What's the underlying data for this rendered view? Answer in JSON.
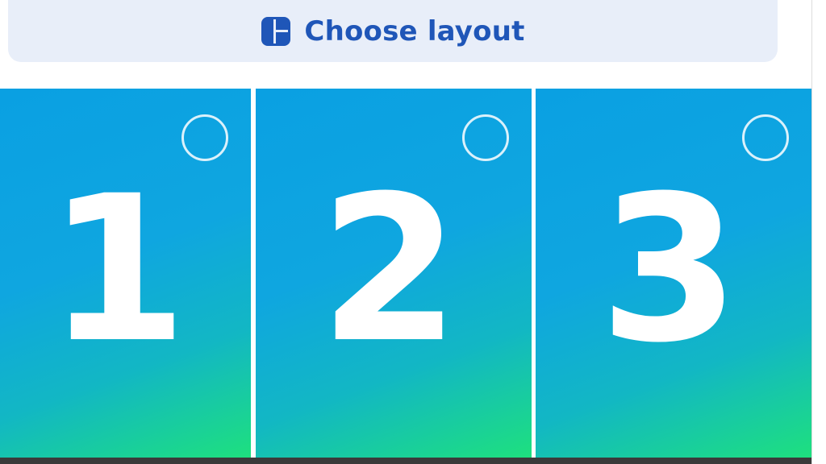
{
  "header": {
    "title": "Choose layout",
    "icon": "layout-icon",
    "accent_color": "#1f56b8",
    "background_color": "#e8eef9"
  },
  "tiles": [
    {
      "label": "1",
      "selected": false
    },
    {
      "label": "2",
      "selected": false
    },
    {
      "label": "3",
      "selected": false
    }
  ],
  "tile_gradient": [
    "#0aa0e2",
    "#1ee07e"
  ]
}
